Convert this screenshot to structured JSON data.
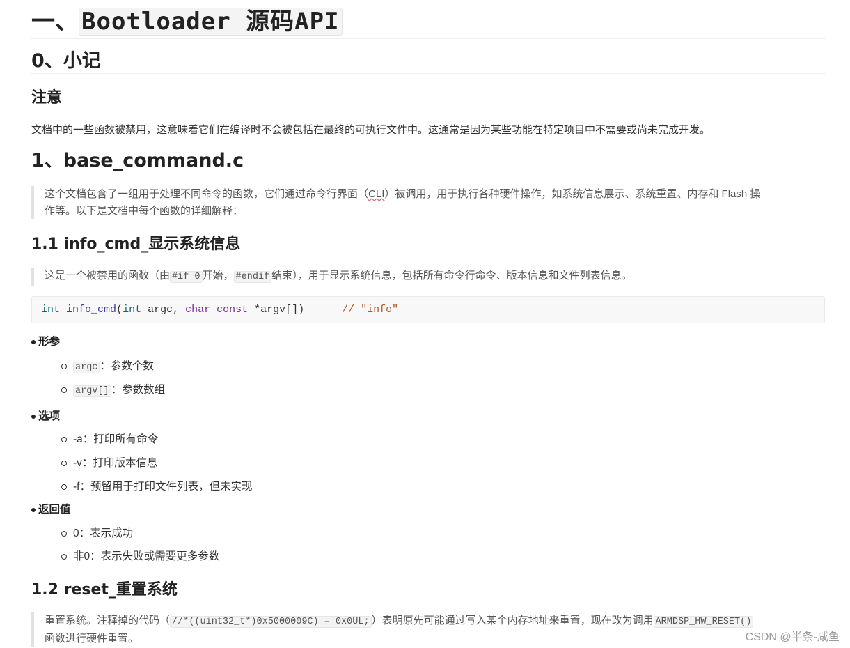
{
  "h1": {
    "prefix": "一、",
    "code": "Bootloader 源码API"
  },
  "s0": {
    "title": "0、小记"
  },
  "notice": {
    "title": "注意",
    "text": "文档中的一些函数被禁用，这意味着它们在编译时不会被包括在最终的可执行文件中。这通常是因为某些功能在特定项目中不需要或尚未完成开发。"
  },
  "s1": {
    "title": "1、base_command.c",
    "quote_a": "这个文档包含了一组用于处理不同命令的函数，它们通过命令行界面（",
    "quote_cli": "CLI",
    "quote_b": "）被调用，用于执行各种硬件操作，如系统信息展示、系统重置、内存和 Flash 操",
    "quote_line2": "作等。以下是文档中每个函数的详细解释："
  },
  "s11": {
    "title": "1.1  info_cmd_显示系统信息",
    "quote_a": "这是一个被禁用的函数（由",
    "quote_code1": "#if 0",
    "quote_b": "开始，",
    "quote_code2": "#endif",
    "quote_c": "结束），用于显示系统信息，包括所有命令行命令、版本信息和文件列表信息。",
    "code": {
      "t1": "int",
      "fn": "info_cmd",
      "p1": "(",
      "t2": "int",
      "p2": " argc, ",
      "t3": "char",
      "sp": " ",
      "t4": "const",
      "p3": " *argv[])      ",
      "comment": "// \"info\""
    },
    "params": {
      "title": "形参",
      "items": [
        {
          "code": "argc",
          "desc": "：参数个数"
        },
        {
          "code": "argv[]",
          "desc": "：参数数组"
        }
      ]
    },
    "options": {
      "title": "选项",
      "items": [
        "-a：打印所有命令",
        "-v：打印版本信息",
        "-f：预留用于打印文件列表，但未实现"
      ]
    },
    "returns": {
      "title": "返回值",
      "items": [
        "0：表示成功",
        "非0：表示失败或需要更多参数"
      ]
    }
  },
  "s12": {
    "title": "1.2 reset_重置系统",
    "quote_a": "重置系统。注释掉的代码（",
    "quote_code1": "//*((uint32_t*)0x5000009C) = 0x0UL;",
    "quote_b": "）表明原先可能通过写入某个内存地址来重置，现在改为调用",
    "quote_code2": "ARMDSP_HW_RESET()",
    "quote_line2": "函数进行硬件重置。"
  },
  "watermark": "CSDN @半条-咸鱼"
}
